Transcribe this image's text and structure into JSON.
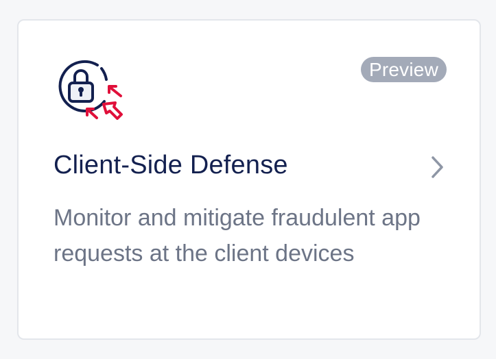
{
  "card": {
    "badge": "Preview",
    "title": "Client-Side Defense",
    "description": "Monitor and mitigate fraudulent app requests at the client devices",
    "icon": "client-side-defense-icon",
    "chevron_icon": "chevron-right-icon"
  },
  "colors": {
    "page_background": "#f6f7f9",
    "card_background": "#ffffff",
    "card_border": "#e3e6eb",
    "title": "#13204f",
    "description": "#6c7486",
    "badge_background": "#a3aab8",
    "icon_primary": "#13204f",
    "icon_accent": "#e0103a",
    "chevron": "#8e96a5"
  }
}
